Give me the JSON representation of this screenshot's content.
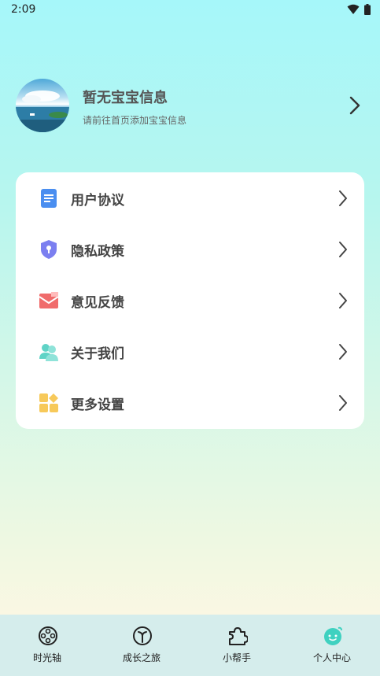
{
  "status_bar": {
    "time": "2:09"
  },
  "profile": {
    "name": "暂无宝宝信息",
    "subtitle": "请前往首页添加宝宝信息"
  },
  "menu": {
    "items": [
      {
        "label": "用户协议",
        "icon": "document-icon",
        "color": "#4a8ef0"
      },
      {
        "label": "隐私政策",
        "icon": "shield-lock-icon",
        "color": "#7b7ff0"
      },
      {
        "label": "意见反馈",
        "icon": "mail-icon",
        "color": "#f06b6b"
      },
      {
        "label": "关于我们",
        "icon": "users-icon",
        "color": "#5fd3c6"
      },
      {
        "label": "更多设置",
        "icon": "grid-icon",
        "color": "#f7c95a"
      }
    ]
  },
  "tabbar": {
    "tabs": [
      {
        "label": "时光轴",
        "icon": "film-reel-icon"
      },
      {
        "label": "成长之旅",
        "icon": "sprout-icon"
      },
      {
        "label": "小帮手",
        "icon": "puzzle-icon"
      },
      {
        "label": "个人中心",
        "icon": "smiley-icon",
        "active_color": "#3fd1c0"
      }
    ]
  }
}
